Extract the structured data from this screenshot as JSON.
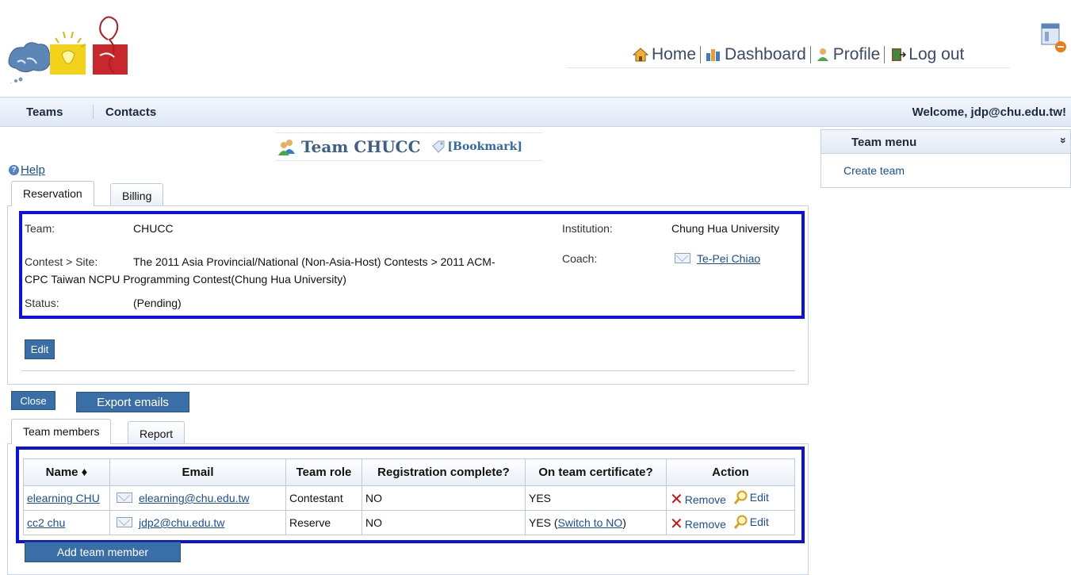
{
  "topnav": {
    "home": "Home",
    "dashboard": "Dashboard",
    "profile": "Profile",
    "logout": "Log out"
  },
  "menubar": {
    "teams": "Teams",
    "contacts": "Contacts",
    "welcome": "Welcome, jdp@chu.edu.tw!"
  },
  "team_title": {
    "name": "Team CHUCC",
    "bookmark": "[Bookmark]"
  },
  "help": "Help",
  "reservation_tabs": [
    {
      "label": "Reservation"
    },
    {
      "label": "Billing"
    }
  ],
  "reservation": {
    "team_label": "Team:",
    "team_value": "CHUCC",
    "contest_label": "Contest > Site:",
    "contest_value_line1": "The 2011 Asia Provincial/National (Non-Asia-Host) Contests > 2011 ACM-",
    "contest_value_line2": "CPC Taiwan NCPU Programming Contest(Chung Hua University)",
    "status_label": "Status:",
    "status_value": "(Pending)",
    "institution_label": "Institution:",
    "institution_value": "Chung Hua University",
    "coach_label": "Coach:",
    "coach_value": "Te-Pei Chiao",
    "edit_button": "Edit"
  },
  "buttons": {
    "close": "Close",
    "export_emails": "Export emails",
    "add_member": "Add team member"
  },
  "member_tabs": [
    {
      "label": "Team members"
    },
    {
      "label": "Report"
    }
  ],
  "members_table": {
    "headers": [
      "Name ♦",
      "Email",
      "Team role",
      "Registration complete?",
      "On team certificate?",
      "Action"
    ],
    "rows": [
      {
        "name": "elearning CHU",
        "email": "elearning@chu.edu.tw",
        "role": "Contestant",
        "registration": "NO",
        "certificate": "YES",
        "switch": "",
        "remove": "Remove",
        "edit": "Edit"
      },
      {
        "name": "cc2 chu",
        "email": "jdp2@chu.edu.tw",
        "role": "Reserve",
        "registration": "NO",
        "certificate": "YES (",
        "switch": "Switch to NO",
        "remove": "Remove",
        "edit": "Edit"
      }
    ]
  },
  "sidebar": {
    "title": "Team menu",
    "create_team": "Create team"
  },
  "colors": {
    "highlight_border": "#0a10e6",
    "button_blue": "#3a6ea6",
    "link_blue": "#1a4fa0"
  }
}
